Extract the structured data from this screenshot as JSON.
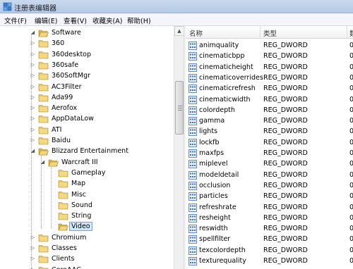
{
  "window": {
    "title": "注册表编辑器"
  },
  "menu": [
    {
      "label": "文件(F)"
    },
    {
      "label": "编辑(E)"
    },
    {
      "label": "查看(V)"
    },
    {
      "label": "收藏夹(A)"
    },
    {
      "label": "帮助(H)"
    }
  ],
  "tree": {
    "items": [
      {
        "label": "Software",
        "expanded": true
      },
      {
        "label": "360"
      },
      {
        "label": "360desktop"
      },
      {
        "label": "360safe"
      },
      {
        "label": "360SoftMgr"
      },
      {
        "label": "AC3Filter"
      },
      {
        "label": "Ada99"
      },
      {
        "label": "Aerofox"
      },
      {
        "label": "AppDataLow"
      },
      {
        "label": "ATI"
      },
      {
        "label": "Baidu"
      },
      {
        "label": "Blizzard Entertainment",
        "expanded": true
      },
      {
        "label": "Warcraft III",
        "expanded": true
      },
      {
        "label": "Gameplay"
      },
      {
        "label": "Map"
      },
      {
        "label": "Misc"
      },
      {
        "label": "Sound"
      },
      {
        "label": "String"
      },
      {
        "label": "Video",
        "selected": true
      },
      {
        "label": "Chromium"
      },
      {
        "label": "Classes"
      },
      {
        "label": "Clients"
      },
      {
        "label": "CoreAAC"
      }
    ]
  },
  "list": {
    "columns": {
      "name": "名称",
      "type": "类型",
      "data": "数"
    },
    "rows": [
      {
        "name": "animquality",
        "type": "REG_DWORD",
        "data": "0"
      },
      {
        "name": "cinematicbpp",
        "type": "REG_DWORD",
        "data": "0"
      },
      {
        "name": "cinematicheight",
        "type": "REG_DWORD",
        "data": "0"
      },
      {
        "name": "cinematicoverrides",
        "type": "REG_DWORD",
        "data": "0"
      },
      {
        "name": "cinematicrefresh",
        "type": "REG_DWORD",
        "data": "0"
      },
      {
        "name": "cinematicwidth",
        "type": "REG_DWORD",
        "data": "0"
      },
      {
        "name": "colordepth",
        "type": "REG_DWORD",
        "data": "0"
      },
      {
        "name": "gamma",
        "type": "REG_DWORD",
        "data": "0"
      },
      {
        "name": "lights",
        "type": "REG_DWORD",
        "data": "0"
      },
      {
        "name": "lockfb",
        "type": "REG_DWORD",
        "data": "0"
      },
      {
        "name": "maxfps",
        "type": "REG_DWORD",
        "data": "0"
      },
      {
        "name": "miplevel",
        "type": "REG_DWORD",
        "data": "0"
      },
      {
        "name": "modeldetail",
        "type": "REG_DWORD",
        "data": "0"
      },
      {
        "name": "occlusion",
        "type": "REG_DWORD",
        "data": "0"
      },
      {
        "name": "particles",
        "type": "REG_DWORD",
        "data": "0"
      },
      {
        "name": "refreshrate",
        "type": "REG_DWORD",
        "data": "0"
      },
      {
        "name": "resheight",
        "type": "REG_DWORD",
        "data": "0"
      },
      {
        "name": "reswidth",
        "type": "REG_DWORD",
        "data": "0"
      },
      {
        "name": "spellfilter",
        "type": "REG_DWORD",
        "data": "0"
      },
      {
        "name": "texcolordepth",
        "type": "REG_DWORD",
        "data": "0"
      },
      {
        "name": "texturequality",
        "type": "REG_DWORD",
        "data": "0"
      }
    ]
  },
  "icons": {
    "app": "registry-editor-icon",
    "folder": "folder-icon",
    "value": "reg-dword-icon",
    "toggle_collapsed": "triangle-right-icon",
    "toggle_expanded": "triangle-down-icon"
  },
  "colors": {
    "folder": "#e9c863",
    "selection": "#cde8ff",
    "reg_icon": "#3a6fc4"
  }
}
